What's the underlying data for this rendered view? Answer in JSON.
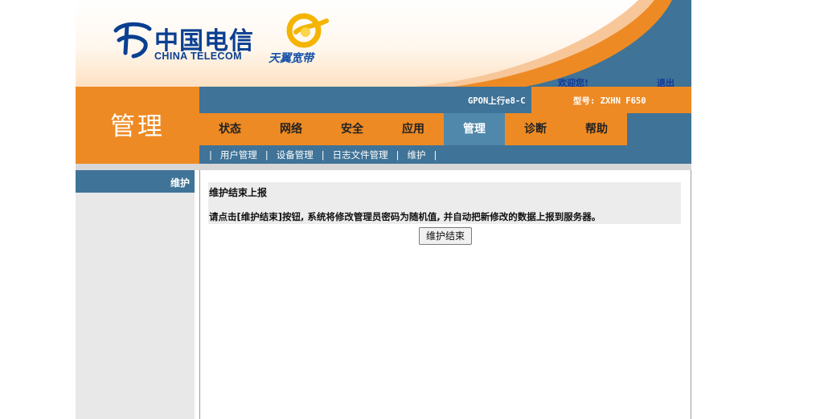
{
  "brand": {
    "company_cn": "中国电信",
    "company_en": "CHINA TELECOM",
    "product": "天翼宽带",
    "colors": {
      "orange": "#ee8a23",
      "steel_blue": "#3f7397",
      "logo_blue": "#0a3f91",
      "gold": "#f4b400"
    }
  },
  "header": {
    "welcome": "欢迎您!",
    "logout": "退出"
  },
  "section_title": "管理",
  "infobar": {
    "gpon": "GPON上行e8-C",
    "model": "型号: ZXHN F650"
  },
  "tabs": [
    {
      "label": "状态",
      "active": false
    },
    {
      "label": "网络",
      "active": false
    },
    {
      "label": "安全",
      "active": false
    },
    {
      "label": "应用",
      "active": false
    },
    {
      "label": "管理",
      "active": true
    },
    {
      "label": "诊断",
      "active": false
    },
    {
      "label": "帮助",
      "active": false
    }
  ],
  "subnav": {
    "sep": "|",
    "items": [
      "用户管理",
      "设备管理",
      "日志文件管理",
      "维护"
    ]
  },
  "sidebar": {
    "items": [
      {
        "label": "维护"
      }
    ]
  },
  "content": {
    "title": "维护结束上报",
    "description": "请点击[维护结束]按钮, 系统将修改管理员密码为随机值, 并自动把新修改的数据上报到服务器。",
    "button_label": "维护结束"
  }
}
